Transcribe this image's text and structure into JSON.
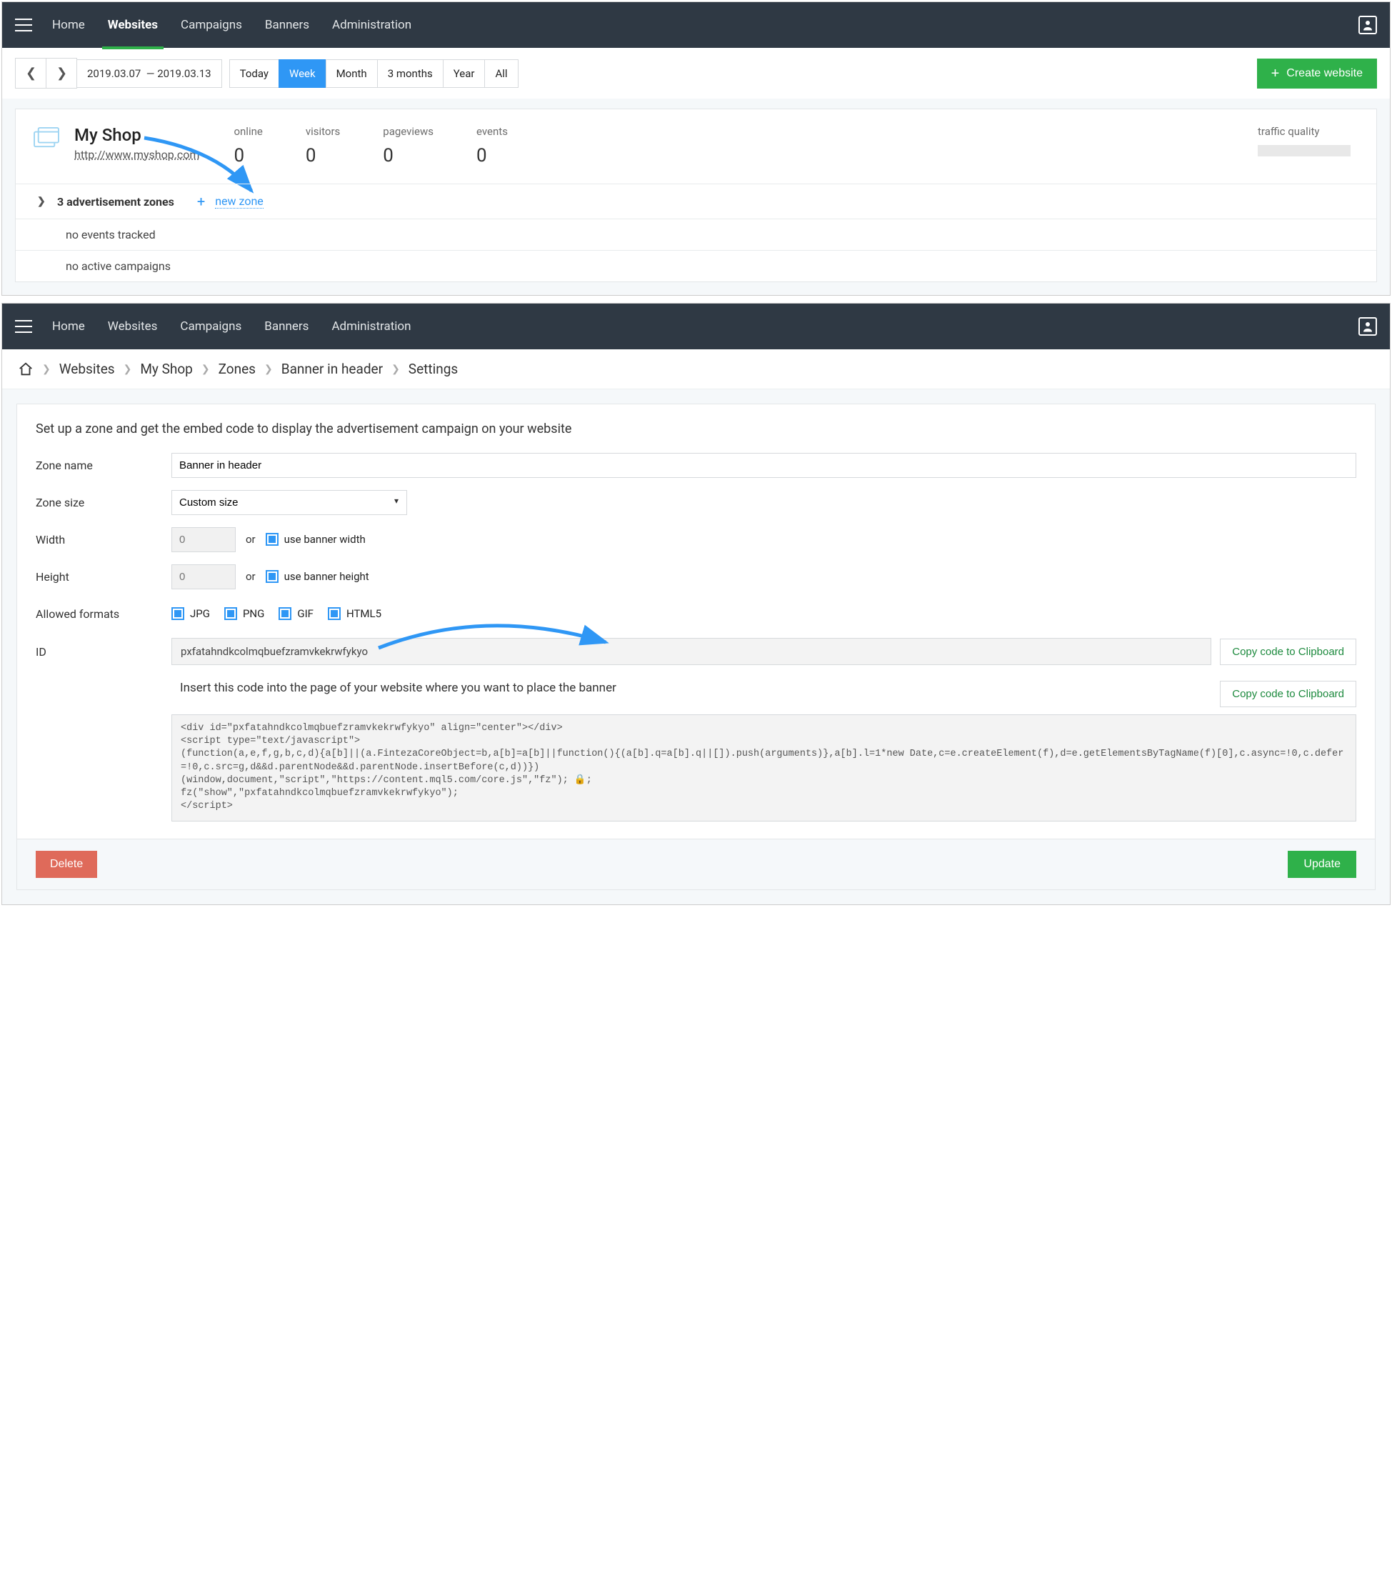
{
  "nav": {
    "items": [
      "Home",
      "Websites",
      "Campaigns",
      "Banners",
      "Administration"
    ],
    "active": "Websites"
  },
  "dateRange": {
    "from": "2019.03.07",
    "to": "2019.03.13"
  },
  "rangeButtons": [
    "Today",
    "Week",
    "Month",
    "3 months",
    "Year",
    "All"
  ],
  "activeRange": "Week",
  "createWebsite": "Create website",
  "site": {
    "name": "My Shop",
    "url": "http://www.myshop.com",
    "stats": {
      "online": {
        "label": "online",
        "value": "0"
      },
      "visitors": {
        "label": "visitors",
        "value": "0"
      },
      "pageviews": {
        "label": "pageviews",
        "value": "0"
      },
      "events": {
        "label": "events",
        "value": "0"
      }
    },
    "trafficLabel": "traffic quality"
  },
  "rows": {
    "adzones": "3 advertisement zones",
    "newZone": "new zone",
    "noEvents": "no events tracked",
    "noCampaigns": "no active campaigns"
  },
  "breadcrumb": [
    "Websites",
    "My Shop",
    "Zones",
    "Banner in header",
    "Settings"
  ],
  "settings": {
    "heading": "Set up a zone and get the embed code to display the advertisement campaign on your website",
    "labels": {
      "zoneName": "Zone name",
      "zoneSize": "Zone size",
      "width": "Width",
      "height": "Height",
      "allowedFormats": "Allowed formats",
      "id": "ID"
    },
    "zoneName": "Banner in header",
    "zoneSize": "Custom size",
    "widthPlaceholder": "0",
    "heightPlaceholder": "0",
    "or": "or",
    "useBannerWidth": "use banner width",
    "useBannerHeight": "use banner height",
    "formats": [
      "JPG",
      "PNG",
      "GIF",
      "HTML5"
    ],
    "id": "pxfatahndkcolmqbuefzramvkekrwfykyo",
    "copyBtn": "Copy code to Clipboard",
    "insertText": "Insert this code into the page of your website where you want to place the banner",
    "embedCode": "<div id=\"pxfatahndkcolmqbuefzramvkekrwfykyo\" align=\"center\"></div>\n<script type=\"text/javascript\">\n(function(a,e,f,g,b,c,d){a[b]||(a.FintezaCoreObject=b,a[b]=a[b]||function(){(a[b].q=a[b].q||[]).push(arguments)},a[b].l=1*new Date,c=e.createElement(f),d=e.getElementsByTagName(f)[0],c.async=!0,c.defer=!0,c.src=g,d&&d.parentNode&&d.parentNode.insertBefore(c,d))})\n(window,document,\"script\",\"https://content.mql5.com/core.js\",\"fz\"); 🔒;\nfz(\"show\",\"pxfatahndkcolmqbuefzramvkekrwfykyo\");\n</scr_ipt>"
  },
  "buttons": {
    "delete": "Delete",
    "update": "Update"
  }
}
